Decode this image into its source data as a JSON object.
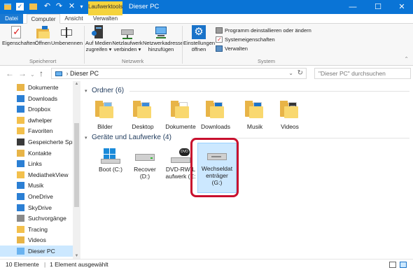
{
  "window": {
    "title": "Dieser PC",
    "context_tab": "Laufwerktools",
    "minimize_icon": "minimize-icon",
    "maximize_icon": "maximize-icon",
    "close_icon": "close-icon"
  },
  "ribbon_tabs": [
    "Datei",
    "Computer",
    "Ansicht",
    "Verwalten"
  ],
  "ribbon": {
    "groups": {
      "speicherort": "Speicherort",
      "netzwerk": "Netzwerk",
      "system": "System"
    },
    "buttons": {
      "eigenschaften": "Eigenschaften",
      "oeffnen": "Öffnen",
      "umbenennen": "Umbenennen",
      "medien_l1": "Auf Medien",
      "medien_l2": "zugreifen ▾",
      "netzlaufwerk_l1": "Netzlaufwerk",
      "netzlaufwerk_l2": "verbinden ▾",
      "netzwerkadresse_l1": "Netzwerkadresse",
      "netzwerkadresse_l2": "hinzufügen",
      "einstellungen_l1": "Einstellungen",
      "einstellungen_l2": "öffnen",
      "programm": "Programm deinstallieren oder ändern",
      "systemeigenschaften": "Systemeigenschaften",
      "verwalten": "Verwalten"
    }
  },
  "address": {
    "path": "Dieser PC",
    "search_placeholder": "\"Dieser PC\" durchsuchen"
  },
  "nav": [
    {
      "label": "Dokumente",
      "icon": "documents-icon"
    },
    {
      "label": "Downloads",
      "icon": "downloads-icon"
    },
    {
      "label": "Dropbox",
      "icon": "dropbox-icon"
    },
    {
      "label": "dwhelper",
      "icon": "folder-icon"
    },
    {
      "label": "Favoriten",
      "icon": "favorites-icon"
    },
    {
      "label": "Gespeicherte Spiel",
      "icon": "saved-games-icon"
    },
    {
      "label": "Kontakte",
      "icon": "contacts-icon"
    },
    {
      "label": "Links",
      "icon": "links-icon"
    },
    {
      "label": "MediathekView",
      "icon": "folder-icon"
    },
    {
      "label": "Musik",
      "icon": "music-icon"
    },
    {
      "label": "OneDrive",
      "icon": "onedrive-icon"
    },
    {
      "label": "SkyDrive",
      "icon": "skydrive-icon"
    },
    {
      "label": "Suchvorgänge",
      "icon": "search-folder-icon"
    },
    {
      "label": "Tracing",
      "icon": "folder-icon"
    },
    {
      "label": "Videos",
      "icon": "videos-icon"
    },
    {
      "label": "Dieser PC",
      "icon": "computer-icon"
    }
  ],
  "folders": {
    "heading": "Ordner (6)",
    "items": [
      "Bilder",
      "Desktop",
      "Dokumente",
      "Downloads",
      "Musik",
      "Videos"
    ]
  },
  "drives": {
    "heading": "Geräte und Laufwerke (4)",
    "items": [
      {
        "l1": "Boot (C:)",
        "l2": ""
      },
      {
        "l1": "Recover",
        "l2": "(D:)"
      },
      {
        "l1": "DVD-RW-L",
        "l2": "aufwerk (E:"
      },
      {
        "l1": "Wechseldat",
        "l2": "enträger",
        "l3": "(G:)"
      }
    ]
  },
  "status": {
    "count": "10 Elemente",
    "selection": "1 Element ausgewählt"
  },
  "colors": {
    "title_blue": "#0a74d6",
    "context_yellow": "#f5d33d",
    "selection": "#cce8ff",
    "highlight_red": "#c8102e"
  }
}
